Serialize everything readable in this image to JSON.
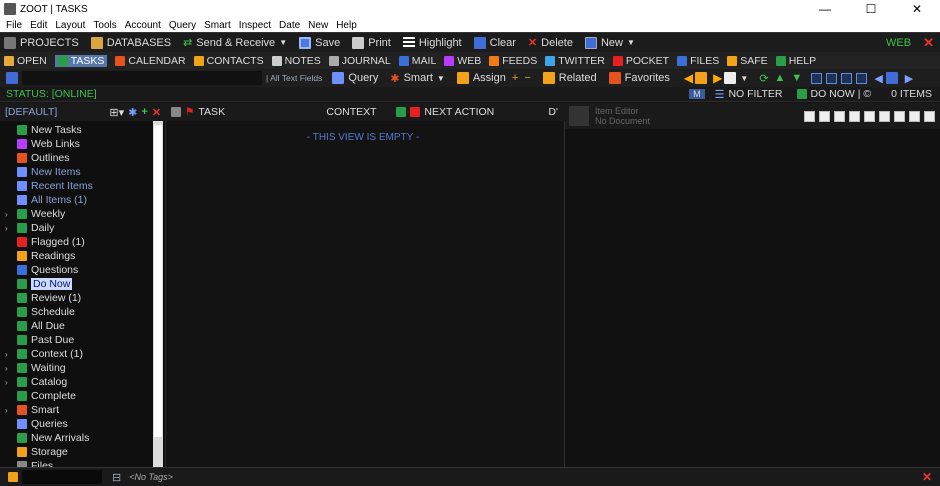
{
  "titlebar": {
    "title": "ZOOT | TASKS",
    "minimize": "—",
    "maximize": "☐",
    "close": "✕"
  },
  "menu": [
    "File",
    "Edit",
    "Layout",
    "Tools",
    "Account",
    "Query",
    "Smart",
    "Inspect",
    "Date",
    "New",
    "Help"
  ],
  "toolbar1": {
    "projects": "PROJECTS",
    "databases": "DATABASES",
    "send_receive": "Send & Receive",
    "save": "Save",
    "print": "Print",
    "highlight": "Highlight",
    "clear": "Clear",
    "delete": "Delete",
    "new": "New",
    "web": "WEB"
  },
  "nav": [
    "OPEN",
    "TASKS",
    "CALENDAR",
    "CONTACTS",
    "NOTES",
    "JOURNAL",
    "MAIL",
    "WEB",
    "FEEDS",
    "TWITTER",
    "POCKET",
    "FILES",
    "SAFE",
    "HELP"
  ],
  "toolbar2": {
    "text_fields": "| All Text Fields",
    "query": "Query",
    "smart": "Smart",
    "assign": "Assign",
    "related": "Related",
    "favorites": "Favorites"
  },
  "status": {
    "label": "STATUS: [ONLINE]",
    "filter_btn": "M",
    "no_filter": "NO FILTER",
    "do_now": "DO NOW | ©",
    "items": "0 ITEMS"
  },
  "panel": {
    "default": "[DEFAULT]",
    "task": "TASK",
    "context": "CONTEXT",
    "next_action": "NEXT ACTION",
    "d_col": "D'"
  },
  "listview": {
    "empty": "- THIS VIEW IS EMPTY -"
  },
  "editor": {
    "title": "Item Editor",
    "subtitle": "No Document"
  },
  "sidebar": [
    {
      "label": "New Tasks",
      "icon": "task-icon",
      "color": "#2a9d4a",
      "exp": ""
    },
    {
      "label": "Web Links",
      "icon": "web-icon",
      "color": "#b63cff",
      "exp": ""
    },
    {
      "label": "Outlines",
      "icon": "outline-icon",
      "color": "#e5521f",
      "exp": ""
    },
    {
      "label": "New Items",
      "icon": "gear-icon",
      "color": "#6f8fff",
      "exp": "",
      "dim": true
    },
    {
      "label": "Recent Items",
      "icon": "gear-icon",
      "color": "#6f8fff",
      "exp": "",
      "dim": true
    },
    {
      "label": "All Items (1)",
      "icon": "gear-icon",
      "color": "#6f8fff",
      "exp": "",
      "dim": true
    },
    {
      "label": "Weekly",
      "icon": "task-icon",
      "color": "#2a9d4a",
      "exp": "›"
    },
    {
      "label": "Daily",
      "icon": "task-icon",
      "color": "#2a9d4a",
      "exp": "›"
    },
    {
      "label": "Flagged (1)",
      "icon": "flag-icon",
      "color": "#e52020",
      "exp": ""
    },
    {
      "label": "Readings",
      "icon": "book-icon",
      "color": "#f2a218",
      "exp": ""
    },
    {
      "label": "Questions",
      "icon": "question-icon",
      "color": "#3a6ed8",
      "exp": ""
    },
    {
      "label": "Do Now",
      "icon": "clock-icon",
      "color": "#2a9d4a",
      "exp": "",
      "selected": true
    },
    {
      "label": "Review (1)",
      "icon": "review-icon",
      "color": "#2a9d4a",
      "exp": ""
    },
    {
      "label": "Schedule",
      "icon": "schedule-icon",
      "color": "#2a9d4a",
      "exp": ""
    },
    {
      "label": "All Due",
      "icon": "due-icon",
      "color": "#2a9d4a",
      "exp": ""
    },
    {
      "label": "Past Due",
      "icon": "pastdue-icon",
      "color": "#2a9d4a",
      "exp": ""
    },
    {
      "label": "Context (1)",
      "icon": "context-icon",
      "color": "#2a9d4a",
      "exp": "›"
    },
    {
      "label": "Waiting",
      "icon": "waiting-icon",
      "color": "#2a9d4a",
      "exp": "›"
    },
    {
      "label": "Catalog",
      "icon": "catalog-icon",
      "color": "#2a9d4a",
      "exp": "›"
    },
    {
      "label": "Complete",
      "icon": "complete-icon",
      "color": "#2a9d4a",
      "exp": ""
    },
    {
      "label": "Smart",
      "icon": "smart-icon",
      "color": "#e5521f",
      "exp": "›"
    },
    {
      "label": "Queries",
      "icon": "query-icon",
      "color": "#6f8fff",
      "exp": ""
    },
    {
      "label": "New Arrivals",
      "icon": "arrivals-icon",
      "color": "#2a9d4a",
      "exp": ""
    },
    {
      "label": "Storage",
      "icon": "storage-icon",
      "color": "#f2a218",
      "exp": ""
    },
    {
      "label": "Files",
      "icon": "files-icon",
      "color": "#888",
      "exp": ""
    }
  ],
  "bottombar": {
    "tags": "<No Tags>",
    "close": "✕"
  }
}
